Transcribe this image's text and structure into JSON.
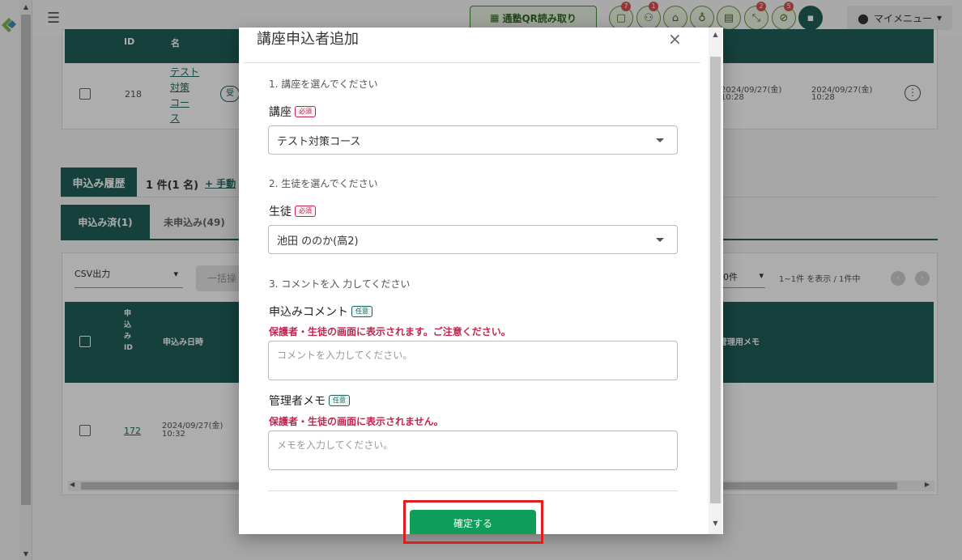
{
  "header": {
    "qr_button": "通塾QR読み取り",
    "my_menu": "マイメニュー",
    "icons": [
      {
        "name": "message-icon",
        "badge": "7"
      },
      {
        "name": "users-icon",
        "badge": "1"
      },
      {
        "name": "school-icon",
        "badge": ""
      },
      {
        "name": "gift-icon",
        "badge": ""
      },
      {
        "name": "chart-icon",
        "badge": ""
      },
      {
        "name": "compress-icon",
        "badge": "2"
      },
      {
        "name": "no-entry-icon",
        "badge": "5"
      },
      {
        "name": "chat-icon",
        "badge": ""
      }
    ]
  },
  "bg": {
    "top_table": {
      "head_id": "ID",
      "head_name": "名",
      "row_id": "218",
      "row_name": [
        "テスト",
        "対策",
        "コー",
        "ス"
      ],
      "row_status": "受付",
      "date1": "2024/09/27(金)",
      "time1": "10:28",
      "date2": "2024/09/27(金)",
      "time2": "10:28"
    },
    "history_title": "申込み履歴",
    "history_count": "1 件(1 名)",
    "manual_link": "+ 手動",
    "tab_applied": "申込み済(1)",
    "tab_unapplied": "未申込み(49)",
    "csv_select": "CSV出力",
    "bulk_button": "一括操",
    "page_size": "0件",
    "paging": "1~1件 を表示 / 1件中",
    "lower_head_id": [
      "申",
      "込",
      "み",
      "ID"
    ],
    "lower_head_date": "申込み日時",
    "lower_head_memo": "管理用メモ",
    "lower_row_id": "172",
    "lower_row_date": "2024/09/27(金)",
    "lower_row_time": "10:32"
  },
  "modal": {
    "title": "講座申込者追加",
    "close": "×",
    "section1": "1. 講座を選んでください",
    "course_label": "講座",
    "required": "必須",
    "course_value": "テスト対策コース",
    "section2": "2. 生徒を選んでください",
    "student_label": "生徒",
    "student_value": "池田 ののか(高2)",
    "section3": "3. コメントを入 力してください",
    "comment_label": "申込みコメント",
    "optional": "任意",
    "comment_warning": "保護者・生徒の画面に表示されます。ご注意ください。",
    "comment_placeholder": "コメントを入力してください。",
    "memo_label": "管理者メモ",
    "memo_warning": "保護者・生徒の画面に表示されません。",
    "memo_placeholder": "メモを入力してください。",
    "confirm_button": "確定する"
  },
  "colors": {
    "accent": "#0f9e5a",
    "teal": "#1f5f59",
    "required": "#c0264e",
    "highlight": "#e11d1d"
  }
}
